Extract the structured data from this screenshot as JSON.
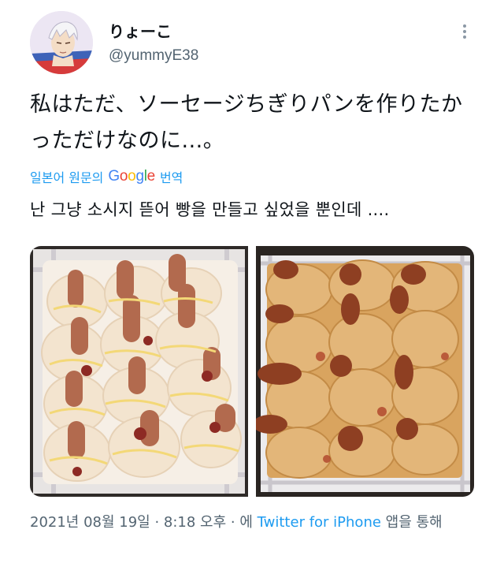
{
  "user": {
    "display_name": "りょーこ",
    "handle": "@yummyE38"
  },
  "tweet": {
    "text": "私はただ、ソーセージちぎりパンを作りたかっただけなのに...。",
    "translate_prefix": "일본어 원문의",
    "translate_provider": "Google",
    "translate_suffix": "번역",
    "translated_text": "난 그냥 소시지 뜯어 빵을 만들고 싶었을 뿐인데 ...."
  },
  "meta": {
    "date_text": "2021년 08월 19일 · 8:18 오후 · 에",
    "source": "Twitter for iPhone",
    "suffix": "앱을 통해"
  },
  "colors": {
    "link": "#1d9bf0",
    "secondary_text": "#536471",
    "primary_text": "#0f1419"
  },
  "icons": {
    "more": "vertical-ellipsis-icon"
  }
}
